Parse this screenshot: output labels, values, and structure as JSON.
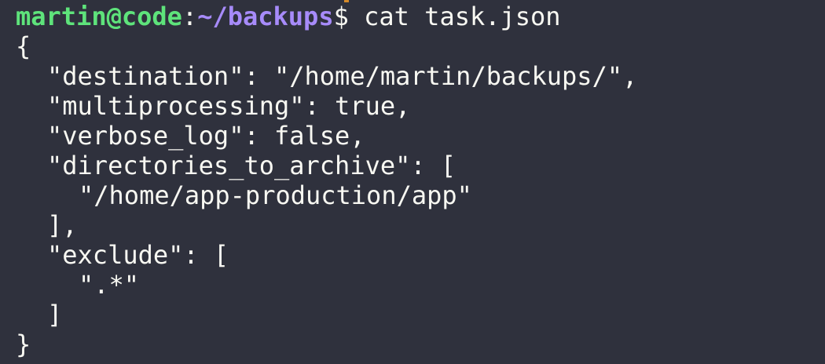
{
  "prompt": {
    "user_host": "martin@code",
    "separator": ":",
    "path": "~/backups",
    "symbol": "$",
    "command": " cat task.json"
  },
  "colors": {
    "background": "#2f313d",
    "user_host": "#5ee37b",
    "path": "#a78bfa",
    "text": "#f8f8f2"
  },
  "output": {
    "open_brace": "{",
    "destination_line": "\"destination\": \"/home/martin/backups/\",",
    "multiprocessing_line": "\"multiprocessing\": true,",
    "verbose_log_line": "\"verbose_log\": false,",
    "directories_line": "\"directories_to_archive\": [",
    "directory_item": "\"/home/app-production/app\"",
    "directories_close": "],",
    "exclude_line": "\"exclude\": [",
    "exclude_item": "\".*\"",
    "exclude_close": "]",
    "close_brace": "}"
  }
}
